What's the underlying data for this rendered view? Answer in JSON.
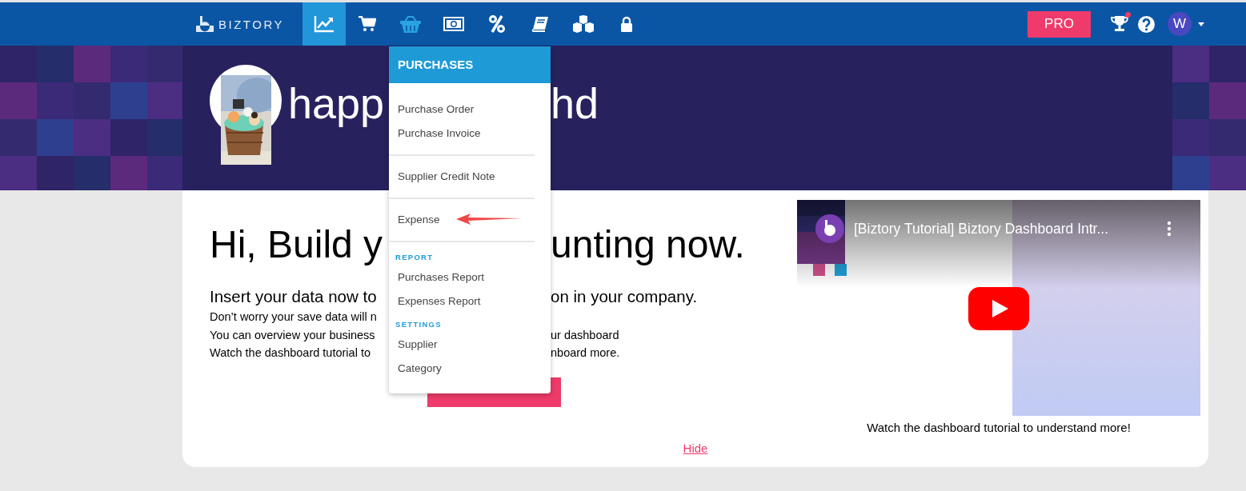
{
  "navbar": {
    "logo": "BIZTORY",
    "items": [
      {
        "kind": "chart",
        "selected": true,
        "open": false
      },
      {
        "kind": "cart",
        "selected": false,
        "open": false
      },
      {
        "kind": "basket",
        "selected": false,
        "open": true
      },
      {
        "kind": "money",
        "selected": false,
        "open": false
      },
      {
        "kind": "percent",
        "selected": false,
        "open": false
      },
      {
        "kind": "book",
        "selected": false,
        "open": false
      },
      {
        "kind": "boxes",
        "selected": false,
        "open": false
      },
      {
        "kind": "lock",
        "selected": false,
        "open": false
      }
    ],
    "pro_button": "PRO",
    "trophy_notification": true,
    "avatar_letter": "W"
  },
  "banner": {
    "name_left": "happ",
    "name_right": "hd"
  },
  "menu": {
    "title": "PURCHASES",
    "entries": [
      {
        "kind": "item",
        "label": "Purchase Order",
        "annotated": false
      },
      {
        "kind": "item",
        "label": "Purchase Invoice",
        "annotated": false
      },
      {
        "kind": "divider"
      },
      {
        "kind": "item",
        "label": "Supplier Credit Note",
        "annotated": false
      },
      {
        "kind": "divider"
      },
      {
        "kind": "item",
        "label": "Expense",
        "annotated": true
      },
      {
        "kind": "divider"
      },
      {
        "kind": "heading",
        "label": "REPORT"
      },
      {
        "kind": "item",
        "label": "Purchases Report",
        "annotated": false
      },
      {
        "kind": "item",
        "label": "Expenses Report",
        "annotated": false
      },
      {
        "kind": "heading",
        "label": "SETTINGS"
      },
      {
        "kind": "item",
        "label": "Supplier",
        "annotated": false
      },
      {
        "kind": "item",
        "label": "Category",
        "annotated": false
      }
    ]
  },
  "welcome": {
    "heading": {
      "left": "Hi, Build y",
      "right": "unting now."
    },
    "subtitle": {
      "left": "Insert your data now to",
      "right": "on in your company."
    },
    "lines": [
      {
        "left": "Don’t worry your save data will n"
      },
      {
        "left": "You can overview your business",
        "right": "ur dashboard"
      },
      {
        "left": "Watch the dashboard tutorial to",
        "right": "nboard more."
      }
    ]
  },
  "video": {
    "title": "[Biztory Tutorial] Biztory Dashboard Intr...",
    "caption": "Watch the dashboard tutorial to understand more!"
  },
  "hide_link": "Hide"
}
